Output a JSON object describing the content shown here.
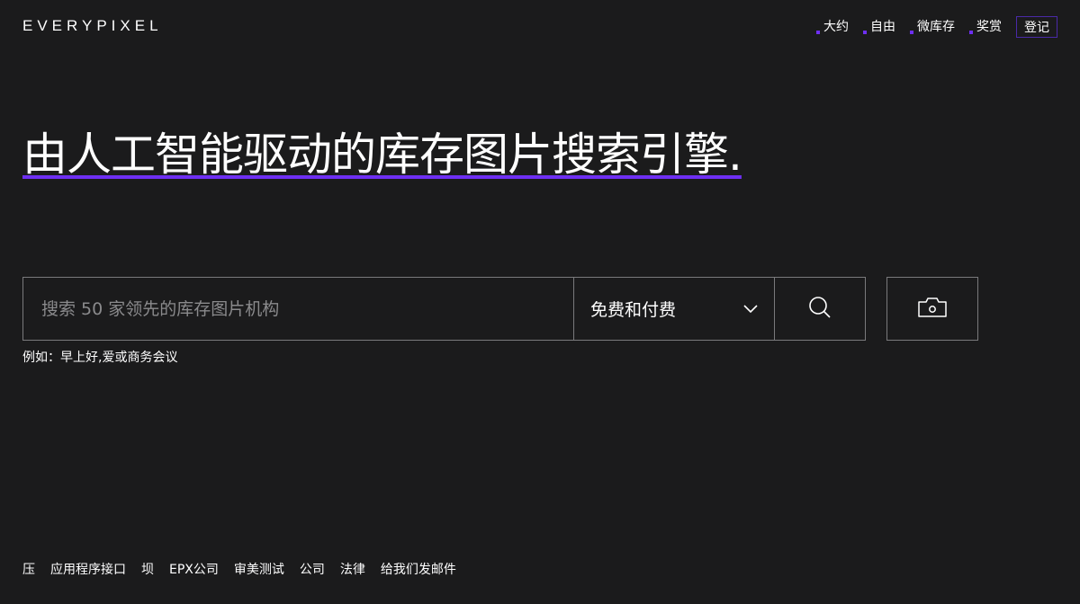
{
  "header": {
    "logo": "EVERYPIXEL",
    "nav": [
      {
        "label": "大约"
      },
      {
        "label": "自由"
      },
      {
        "label": "微库存"
      },
      {
        "label": "奖赏"
      }
    ],
    "login": "登记"
  },
  "hero": {
    "title": "由人工智能驱动的库存图片搜索引擎."
  },
  "search": {
    "placeholder": "搜索 50 家领先的库存图片机构",
    "value": "",
    "filter_selected": "免费和付费",
    "example": "例如：早上好,爱或商务会议"
  },
  "footer": {
    "links": [
      {
        "label": "压"
      },
      {
        "label": "应用程序接口"
      },
      {
        "label": "坝"
      },
      {
        "label": "EPX公司"
      },
      {
        "label": "审美测试"
      },
      {
        "label": "公司"
      },
      {
        "label": "法律"
      },
      {
        "label": "给我们发邮件"
      }
    ]
  },
  "colors": {
    "background": "#1b1b1c",
    "accent": "#6e2ff2",
    "border": "#7a7a7c"
  },
  "icons": {
    "filter": "chevron-down-icon",
    "search": "search-icon",
    "camera": "camera-icon"
  }
}
